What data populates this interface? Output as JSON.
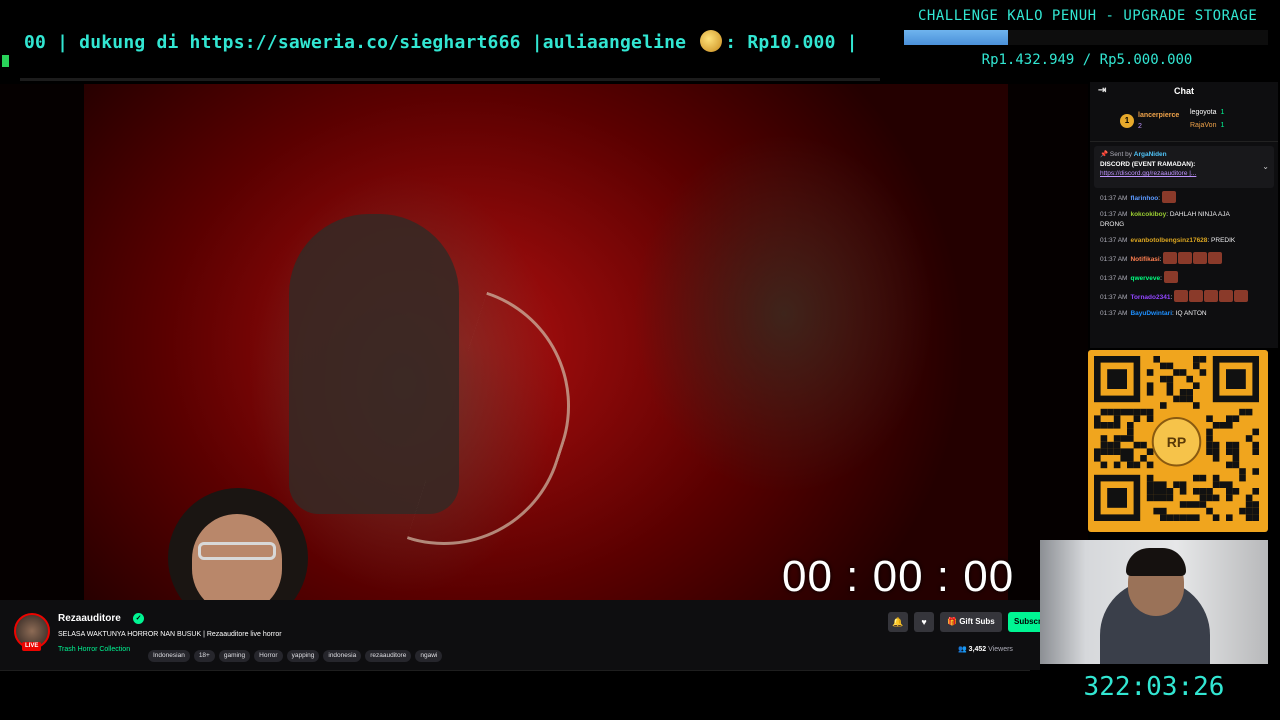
{
  "ticker": {
    "text_before": "00 |  dukung di https://saweria.co/sieghart666 |auliaangeline ",
    "text_after": ": Rp10.000 |"
  },
  "challenge": {
    "title": "CHALLENGE KALO PENUH - UPGRADE STORAGE",
    "amount": "Rp1.432.949 / Rp5.000.000",
    "progress_fraction": 0.2866,
    "bar_color": "#4a90d9"
  },
  "overlay": {
    "countdown": "00 : 00 : 00",
    "clock": "322:03:26"
  },
  "chat": {
    "title": "Chat",
    "collapse_icon": "collapse-icon",
    "leaderboard": {
      "rank": "1",
      "first_user": "lancerpierce",
      "first_count": "2",
      "others": [
        {
          "user": "legoyota",
          "count": "1"
        },
        {
          "user": "RajaVon",
          "count": "1"
        }
      ]
    },
    "pinned": {
      "sent_by_label": "Sent by",
      "sent_by_user": "ArgaNiden",
      "message": "DISCORD (EVENT RAMADAN):",
      "link": "https://discord.gg/rezaauditore |..."
    },
    "messages": [
      {
        "time": "01:37 AM",
        "user": "flarinhoo",
        "user_color": "#5b99ff",
        "text": "",
        "emotes": 1
      },
      {
        "time": "01:37 AM",
        "user": "kokcokiboy",
        "user_color": "#9acd32",
        "text": "DAHLAH NINJA AJA",
        "emotes": 0
      },
      {
        "time": "",
        "user": "",
        "user_color": "#fff",
        "text": "DRONG",
        "emotes": 0
      },
      {
        "time": "01:37 AM",
        "user": "evanbotolbengsinz17628",
        "user_color": "#daa520",
        "text": "PREDIK",
        "emotes": 0
      },
      {
        "time": "01:37 AM",
        "user": "Notifikasi",
        "user_color": "#ff7f50",
        "text": "",
        "emotes": 4
      },
      {
        "time": "01:37 AM",
        "user": "qwerveve",
        "user_color": "#00ff7f",
        "text": "",
        "emotes": 1
      },
      {
        "time": "01:37 AM",
        "user": "Tornado2341",
        "user_color": "#9146ff",
        "text": "",
        "emotes": 5
      },
      {
        "time": "01:37 AM",
        "user": "BayuDwintari",
        "user_color": "#1e90ff",
        "text": "IQ ANTON",
        "emotes": 0
      }
    ]
  },
  "qr": {
    "badge_text": "RP",
    "colors": {
      "bg": "#f0a51e",
      "module": "#111111"
    }
  },
  "stream": {
    "streamer_name": "Rezaauditore",
    "live_label": "LIVE",
    "title": "SELASA WAKTUNYA HORROR NAN BUSUK | Rezaauditore live horror",
    "category": "Trash Horror Collection",
    "tags": [
      "Indonesian",
      "18+",
      "gaming",
      "Horror",
      "yapping",
      "indonesia",
      "rezaauditore",
      "ngawi"
    ],
    "gift_subs_label": "Gift Subs",
    "subscribe_label": "Subscribe",
    "viewers_count": "3,452",
    "viewers_label": "Viewers"
  },
  "colors": {
    "accent_green": "#00f593",
    "overlay_cyan": "#32e6d2",
    "live_red": "#eb0400"
  }
}
